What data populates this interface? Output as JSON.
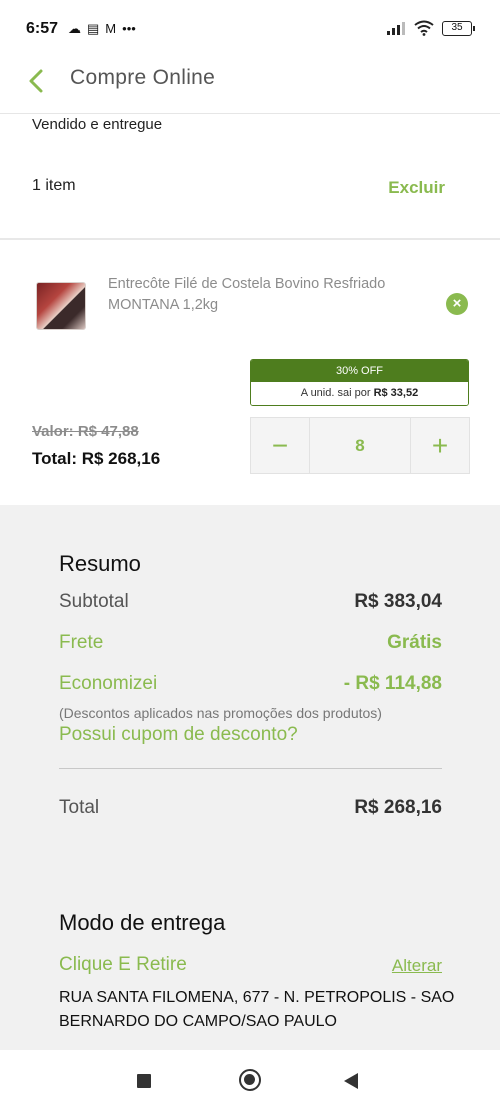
{
  "status_bar": {
    "time": "6:57",
    "left_icons": [
      "cloud-icon",
      "news-icon",
      "gmail-icon",
      "more-dots-icon"
    ],
    "right_icons": [
      "signal-icon",
      "wifi-icon",
      "battery-icon"
    ],
    "battery": "35"
  },
  "header": {
    "title": "Compre Online"
  },
  "seller": {
    "text": "Vendido e entregue"
  },
  "cart": {
    "items_count": "1 item",
    "delete_label": "Excluir"
  },
  "product": {
    "name": "Entrecôte Filé de Costela Bovino Resfriado MONTANA 1,2kg",
    "promo_off": "30% OFF",
    "promo_unit_prefix": "A unid. sai por ",
    "promo_unit_price": "R$ 33,52",
    "old_price": "Valor: R$ 47,88",
    "total": "Total: R$ 268,16",
    "quantity": "8",
    "minus": "−",
    "plus": "+"
  },
  "summary": {
    "title": "Resumo",
    "subtotal_label": "Subtotal",
    "subtotal_value": "R$ 383,04",
    "shipping_label": "Frete",
    "shipping_value": "Grátis",
    "saved_label": "Economizei",
    "saved_value": "- R$ 114,88",
    "discount_note": "(Descontos aplicados nas promoções dos produtos)",
    "coupon_link": "Possui cupom de desconto?",
    "total_label": "Total",
    "total_value": "R$ 268,16"
  },
  "delivery": {
    "title": "Modo de entrega",
    "mode": "Clique E Retire",
    "change_label": "Alterar",
    "address": "RUA SANTA FILOMENA, 677 - N. PETROPOLIS - SAO BERNARDO DO CAMPO/SAO PAULO"
  },
  "colors": {
    "accent_green": "#8aba4f",
    "promo_green": "#4e7d1e",
    "summary_bg": "#f1f1f1"
  }
}
